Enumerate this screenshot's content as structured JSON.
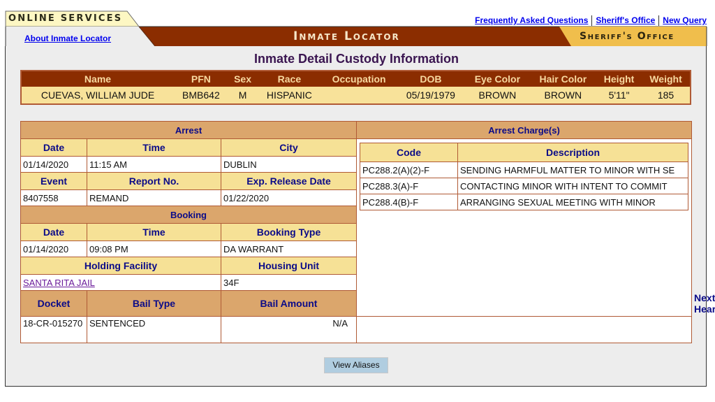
{
  "header": {
    "online_services": "ONLINE SERVICES",
    "app_title": "Inmate Locator",
    "sheriff_label": "Sheriff's Office",
    "about_link": "About Inmate Locator",
    "top_links": [
      "Frequently Asked Questions",
      "Sheriff's Office",
      "New Query"
    ]
  },
  "colors": {
    "banner_brown": "#8b2d00",
    "tab_yellow": "#fdf7c3",
    "sheriff_gold": "#f0be4c",
    "section_tan": "#dba66c",
    "subheader_yellow": "#f6e196",
    "header_text_blue": "#0b0b88",
    "title_purple": "#3a1550",
    "button_blue": "#b0cde0"
  },
  "page_title": "Inmate Detail Custody Information",
  "summary": {
    "headers": [
      "Name",
      "PFN",
      "Sex",
      "Race",
      "Occupation",
      "DOB",
      "Eye Color",
      "Hair Color",
      "Height",
      "Weight"
    ],
    "values": [
      "CUEVAS, WILLIAM JUDE",
      "BMB642",
      "M",
      "HISPANIC",
      "",
      "05/19/1979",
      "BROWN",
      "BROWN",
      "5'11\"",
      "185"
    ]
  },
  "arrest": {
    "title": "Arrest",
    "headers1": [
      "Date",
      "Time",
      "City"
    ],
    "values1": [
      "01/14/2020",
      "11:15 AM",
      "DUBLIN"
    ],
    "headers2": [
      "Event",
      "Report No.",
      "Exp. Release Date"
    ],
    "values2": [
      "8407558",
      "REMAND",
      "01/22/2020"
    ]
  },
  "booking": {
    "title": "Booking",
    "headers1": [
      "Date",
      "Time",
      "Booking Type"
    ],
    "values1": [
      "01/14/2020",
      "09:08 PM",
      "DA WARRANT"
    ],
    "headers2": [
      "Holding Facility",
      "Housing Unit"
    ],
    "facility_link": "SANTA RITA JAIL",
    "housing_unit": "34F"
  },
  "bail": {
    "headers": [
      "Docket",
      "Bail Type",
      "Bail Amount"
    ],
    "values": [
      "18-CR-015270",
      "SENTENCED",
      "N/A"
    ]
  },
  "charges": {
    "title": "Arrest Charge(s)",
    "headers": [
      "Code",
      "Description"
    ],
    "rows": [
      {
        "code": "PC288.2(A)(2)-F",
        "description": "SENDING HARMFUL MATTER TO MINOR WITH SE"
      },
      {
        "code": "PC288.3(A)-F",
        "description": "CONTACTING MINOR WITH INTENT TO COMMIT"
      },
      {
        "code": "PC288.4(B)-F",
        "description": "ARRANGING SEXUAL MEETING WITH MINOR"
      }
    ]
  },
  "hearings": {
    "title": "Next Hearing(s)",
    "value": ""
  },
  "buttons": {
    "view_aliases": "View Aliases"
  }
}
